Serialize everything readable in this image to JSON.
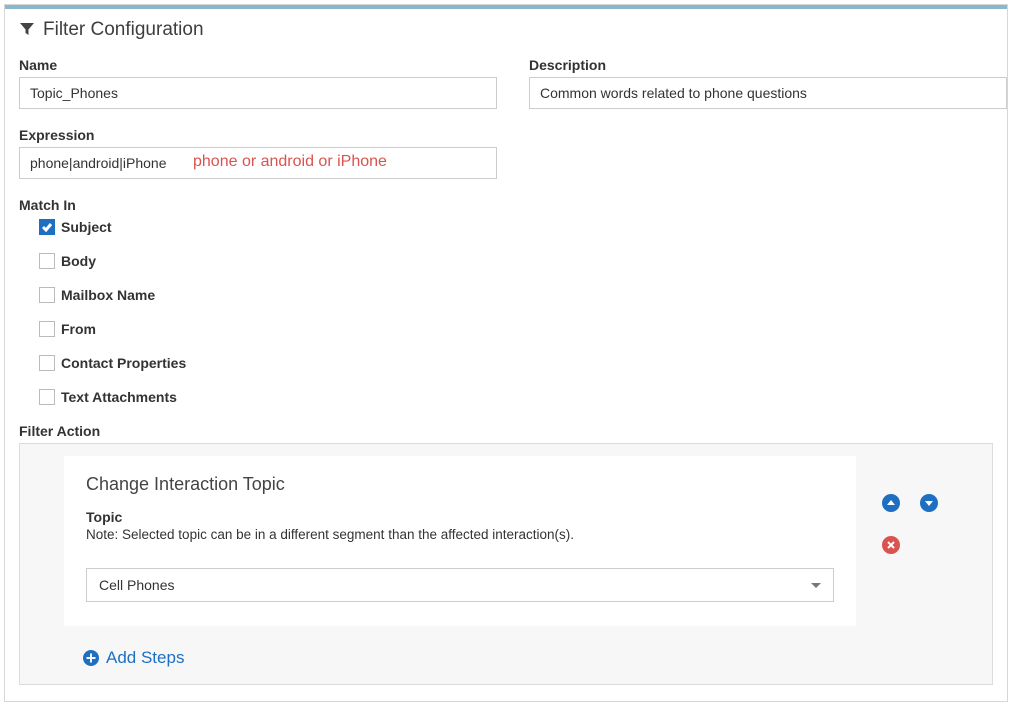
{
  "panel": {
    "title": "Filter Configuration"
  },
  "fields": {
    "name": {
      "label": "Name",
      "value": "Topic_Phones"
    },
    "description": {
      "label": "Description",
      "value": "Common words related to phone questions"
    },
    "expression": {
      "label": "Expression",
      "value": "phone|android|iPhone",
      "annotation": "phone or android or iPhone"
    }
  },
  "matchIn": {
    "label": "Match In",
    "options": [
      {
        "label": "Subject",
        "checked": true
      },
      {
        "label": "Body",
        "checked": false
      },
      {
        "label": "Mailbox Name",
        "checked": false
      },
      {
        "label": "From",
        "checked": false
      },
      {
        "label": "Contact Properties",
        "checked": false
      },
      {
        "label": "Text Attachments",
        "checked": false
      }
    ]
  },
  "filterAction": {
    "label": "Filter Action",
    "step": {
      "title": "Change Interaction Topic",
      "topicLabel": "Topic",
      "note": "Note: Selected topic can be in a different segment than the affected interaction(s).",
      "selected": "Cell Phones"
    },
    "addSteps": "Add Steps"
  }
}
